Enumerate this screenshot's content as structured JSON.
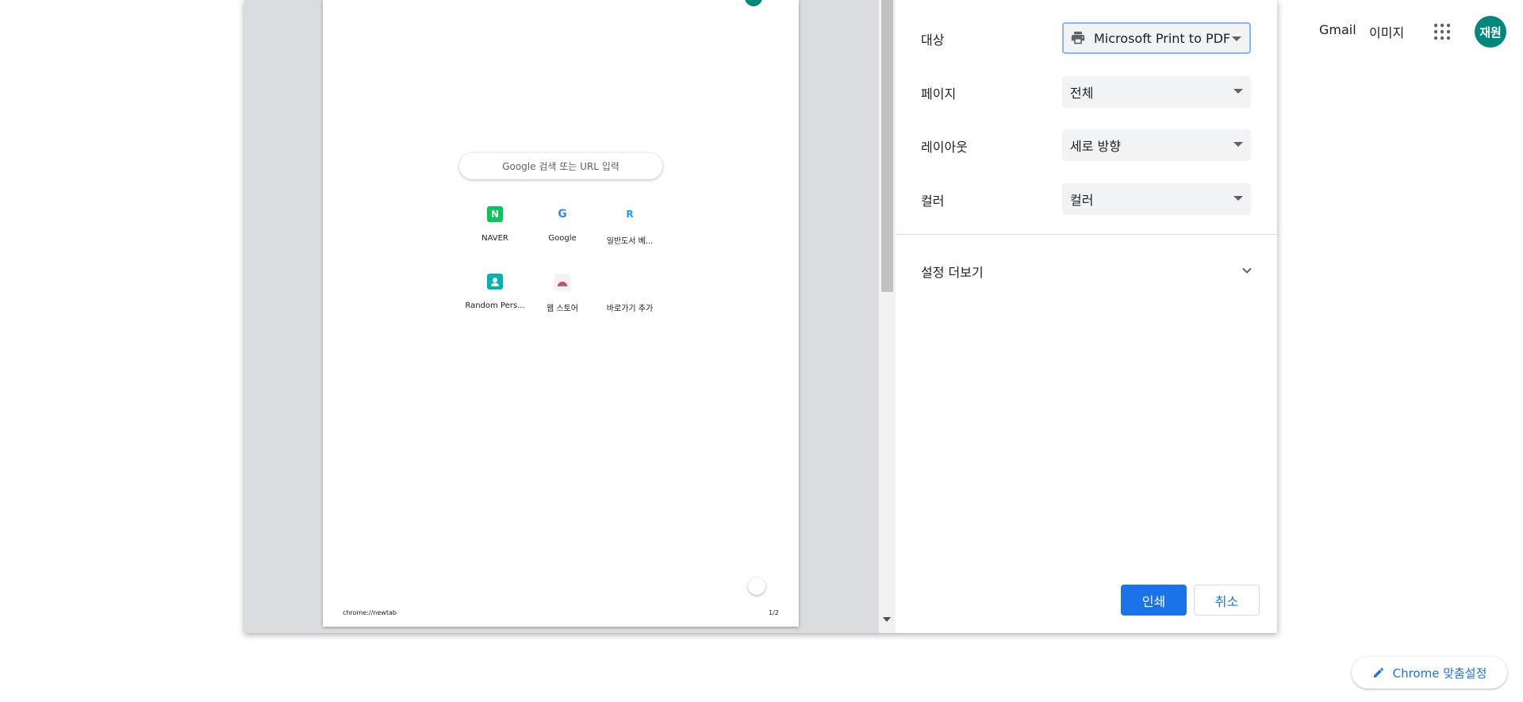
{
  "background": {
    "links": [
      "Gmail",
      "이미지"
    ],
    "avatar_text": "재원",
    "customize_label": "Chrome 맞춤설정"
  },
  "preview": {
    "search_placeholder": "Google 검색 또는 URL 입력",
    "tiles": [
      {
        "label": "NAVER",
        "icon": "naver-icon",
        "glyph": "N",
        "color": "#03c75a"
      },
      {
        "label": "Google",
        "icon": "google-icon",
        "glyph": "G",
        "color": "#4285f4"
      },
      {
        "label": "일반도서 베...",
        "icon": "ridi-icon",
        "glyph": "R",
        "color": "#1e9eff"
      },
      {
        "label": "Random Pers...",
        "icon": "person-icon",
        "glyph": "",
        "color": "#00b3b3"
      },
      {
        "label": "웹 스토어",
        "icon": "webstore-icon",
        "glyph": "",
        "color": "#ea4335"
      },
      {
        "label": "바로가기 추가",
        "icon": "add-shortcut-icon",
        "glyph": "",
        "color": "#ffffff"
      }
    ],
    "footer_url": "chrome://newtab",
    "footer_page": "1/2"
  },
  "settings": {
    "destination": {
      "label": "대상",
      "value": "Microsoft Print to PDF",
      "icon": "printer-icon"
    },
    "pages": {
      "label": "페이지",
      "value": "전체"
    },
    "layout": {
      "label": "레이아웃",
      "value": "세로 방향"
    },
    "color": {
      "label": "컬러",
      "value": "컬러"
    },
    "more_settings": "설정 더보기",
    "print_button": "인쇄",
    "cancel_button": "취소"
  },
  "colors": {
    "accent": "#1a73e8",
    "avatar": "#00897b",
    "preview_bg": "#dadce0"
  }
}
